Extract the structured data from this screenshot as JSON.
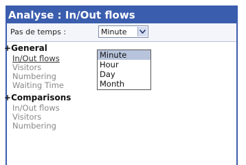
{
  "window": {
    "title": "Analyse : In/Out flows",
    "accent_color": "#3a5dae"
  },
  "timestep": {
    "label": "Pas de temps :",
    "selected": "Minute",
    "options": [
      "Minute",
      "Hour",
      "Day",
      "Month"
    ],
    "arrow_icon": "chevron-down-icon"
  },
  "sections": [
    {
      "toggle": "+",
      "title": "General",
      "items": [
        "In/Out flows",
        "Visitors",
        "Numbering",
        "Waiting Time"
      ]
    },
    {
      "toggle": "+",
      "title": "Comparisons",
      "items": [
        "In/Out flows",
        "Visitors",
        "Numbering"
      ]
    }
  ]
}
